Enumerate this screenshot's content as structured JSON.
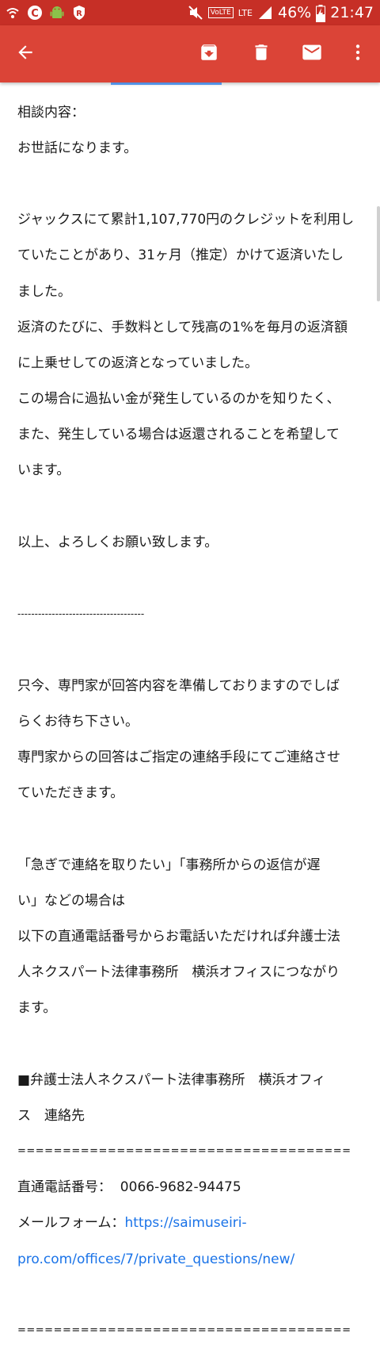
{
  "status_bar": {
    "battery_percent": "46%",
    "time": "21:47",
    "network_label": "LTE",
    "volte_label": "VoLTE",
    "colors": {
      "background": "#c62f26"
    }
  },
  "app_bar": {
    "colors": {
      "background": "#db4437"
    },
    "icons": {
      "back": "arrow-back-icon",
      "archive": "archive-icon",
      "delete": "trash-icon",
      "mail": "mail-icon",
      "overflow": "more-vert-icon"
    }
  },
  "email": {
    "body": {
      "line_01": "相談内容：",
      "line_02": "お世話になります。",
      "line_03": "",
      "line_04": "ジャックスにて累計1,107,770円のクレジットを利用し",
      "line_05": "ていたことがあり、31ヶ月（推定）かけて返済いたし",
      "line_06": "ました。",
      "line_07": "返済のたびに、手数料として残高の1%を毎月の返済額",
      "line_08": "に上乗せしての返済となっていました。",
      "line_09": "この場合に過払い金が発生しているのかを知りたく、",
      "line_10": "また、発生している場合は返還されることを希望して",
      "line_11": "います。",
      "line_12": "",
      "line_13": "以上、よろしくお願い致します。",
      "line_14": "",
      "line_15": "-------------------------------------",
      "line_16": "",
      "line_17": "只今、専門家が回答内容を準備しておりますのでしば",
      "line_18": "らくお待ち下さい。",
      "line_19": "専門家からの回答はご指定の連絡手段にてご連絡させ",
      "line_20": "ていただきます。",
      "line_21": "",
      "line_22": "「急ぎで連絡を取りたい」「事務所からの返信が遅",
      "line_23": "い」などの場合は",
      "line_24": "以下の直通電話番号からお電話いただければ弁護士法",
      "line_25": "人ネクスパート法律事務所　横浜オフィスにつながり",
      "line_26": "ます。",
      "line_27": "",
      "line_28": "■弁護士法人ネクスパート法律事務所　横浜オフィ",
      "line_29": "ス　連絡先",
      "line_30": "=====================================",
      "line_31": "直通電話番号：  0066-9682-94475",
      "line_32_label": "メールフォーム：",
      "line_32_link": "https://saimuseiri-",
      "line_33_link": "pro.com/offices/7/private_questions/new/",
      "line_34": "",
      "line_35": "====================================="
    },
    "colors": {
      "link": "#1a73e8",
      "text": "#1a1a1a"
    }
  }
}
